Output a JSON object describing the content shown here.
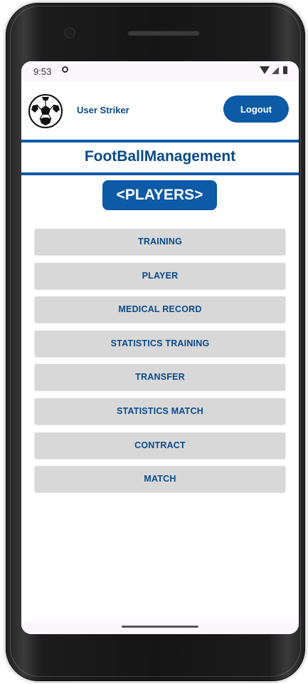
{
  "status_bar": {
    "time": "9:53"
  },
  "header": {
    "user_name": "User Striker",
    "logout_label": "Logout"
  },
  "app_title": "FootBallManagement",
  "role_badge": "<PLAYERS>",
  "menu": {
    "items": [
      {
        "label": "TRAINING"
      },
      {
        "label": "PLAYER"
      },
      {
        "label": "MEDICAL RECORD"
      },
      {
        "label": "STATISTICS TRAINING"
      },
      {
        "label": "TRANSFER"
      },
      {
        "label": "STATISTICS MATCH"
      },
      {
        "label": "CONTRACT"
      },
      {
        "label": "MATCH"
      }
    ]
  },
  "colors": {
    "primary": "#0d5aa6",
    "menu_bg": "#d8d8d8",
    "text_blue": "#0b4a8a"
  },
  "icons": [
    "sync-icon",
    "wifi-icon",
    "signal-icon",
    "battery-icon",
    "soccer-ball-icon"
  ]
}
